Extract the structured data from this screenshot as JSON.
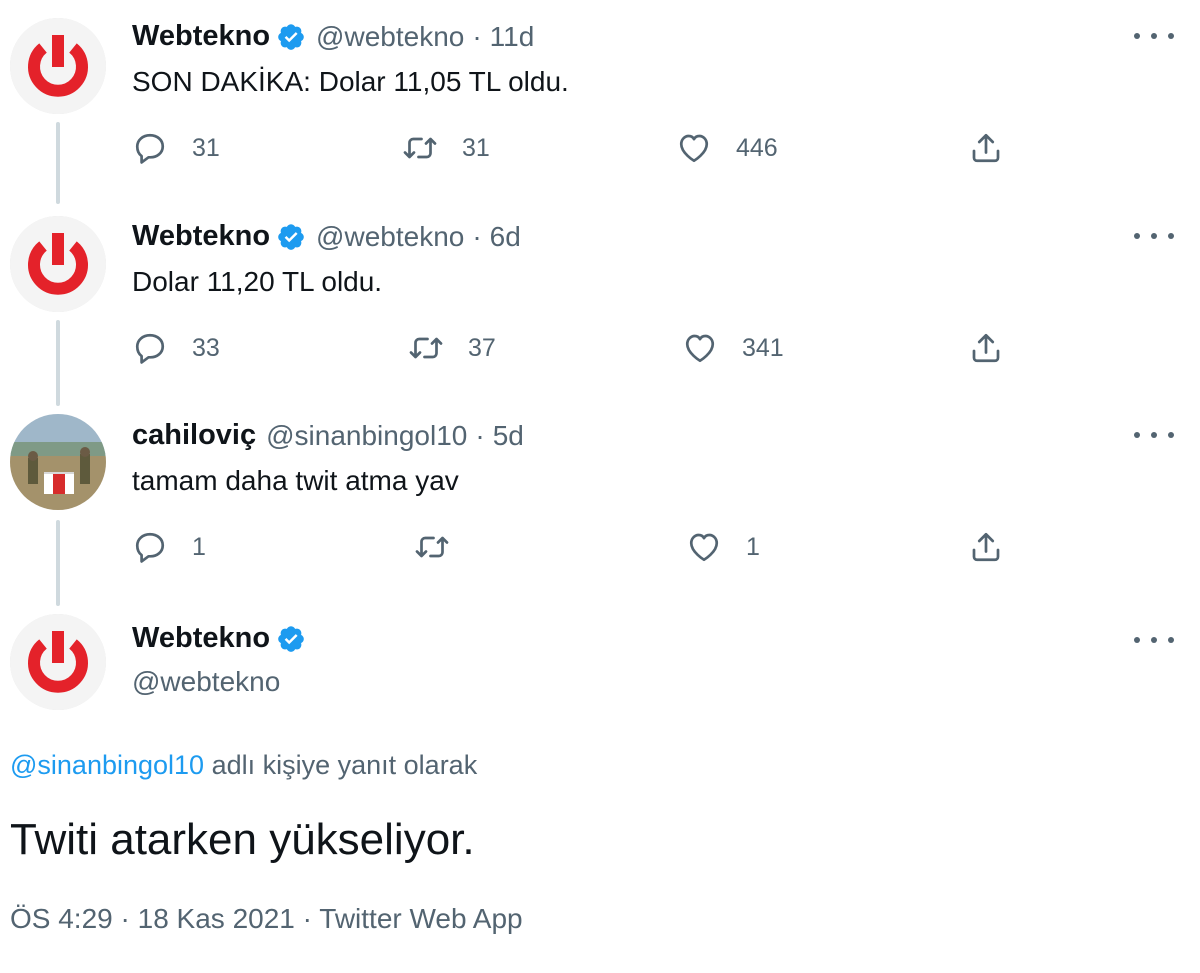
{
  "colors": {
    "accent": "#1d9bf0",
    "brand_red": "#e4222a",
    "text": "#0f1419",
    "muted": "#536471",
    "thread_line": "#cfd9de"
  },
  "tweets": [
    {
      "name": "Webtekno",
      "handle": "@webtekno",
      "sep": "·",
      "time": "11d",
      "text": "SON DAKİKA: Dolar 11,05 TL oldu.",
      "reply_count": "31",
      "retweet_count": "31",
      "like_count": "446"
    },
    {
      "name": "Webtekno",
      "handle": "@webtekno",
      "sep": "·",
      "time": "6d",
      "text": "Dolar 11,20 TL oldu.",
      "reply_count": "33",
      "retweet_count": "37",
      "like_count": "341"
    },
    {
      "name": "cahiloviç",
      "handle": "@sinanbingol10",
      "sep": "·",
      "time": "5d",
      "text": "tamam daha twit atma yav",
      "reply_count": "1",
      "retweet_count": "",
      "like_count": "1"
    }
  ],
  "main_tweet": {
    "name": "Webtekno",
    "handle": "@webtekno",
    "reply_mention": "@sinanbingol10",
    "reply_suffix": "adlı kişiye yanıt olarak",
    "text": "Twiti atarken yükseliyor.",
    "time": "ÖS 4:29",
    "date": "18 Kas 2021",
    "source": "Twitter Web App",
    "sep": "·"
  },
  "icons": {
    "avatar_webtekno": "power-logo-icon",
    "avatar_user": "photo-avatar",
    "verified": "verified-badge-icon",
    "reply": "reply-icon",
    "retweet": "retweet-icon",
    "like": "heart-icon",
    "share": "share-icon",
    "more": "more-icon"
  }
}
